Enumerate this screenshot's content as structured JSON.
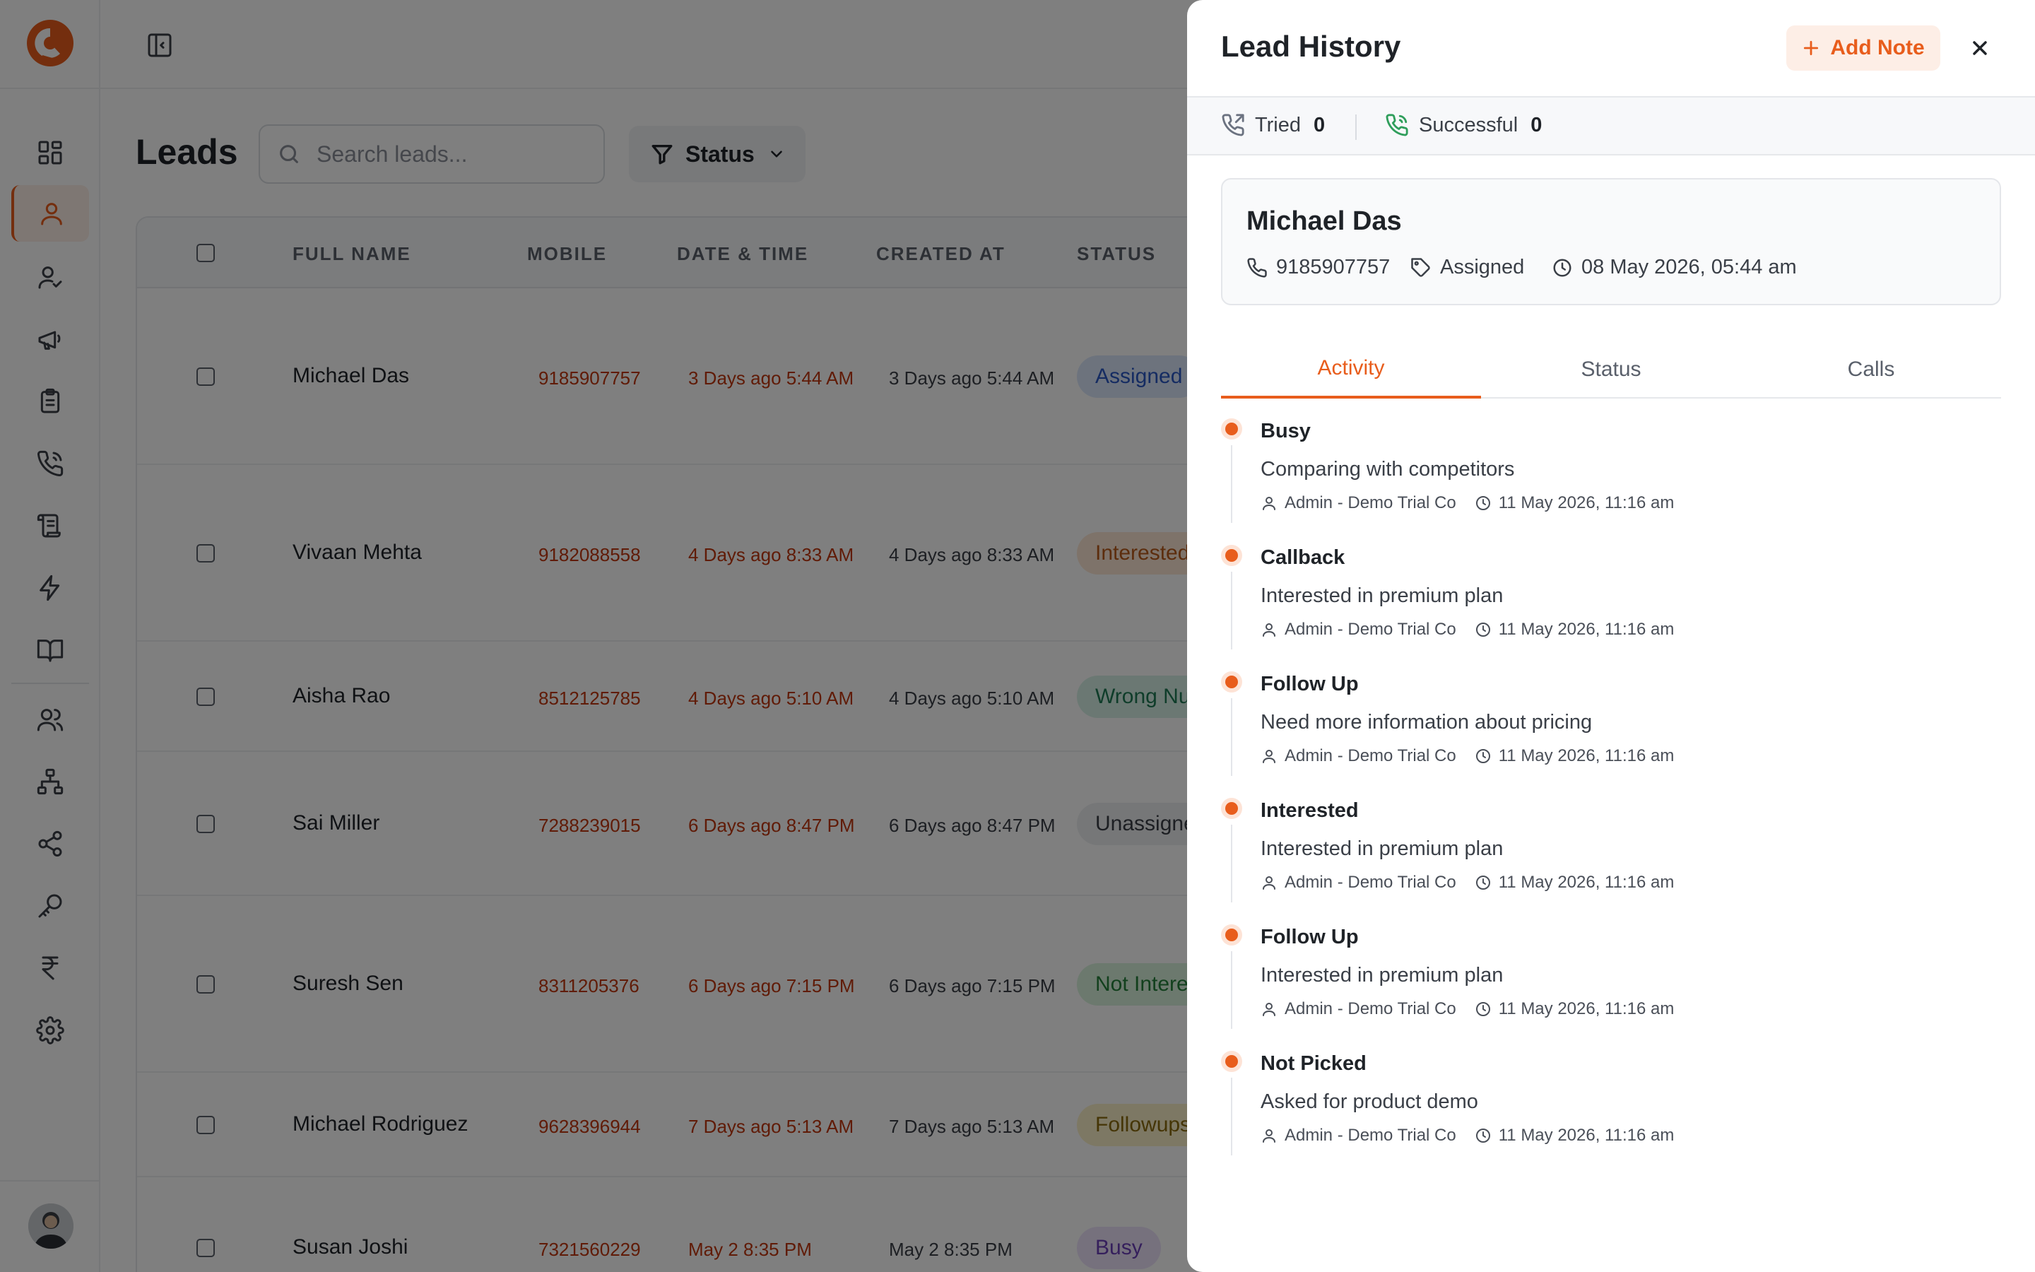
{
  "colors": {
    "accent": "#e85d1c",
    "accent_bg": "#fdeee6",
    "success": "#2f9e5b"
  },
  "sidebar": {
    "items": [
      {
        "icon": "dashboard-icon",
        "active": false
      },
      {
        "icon": "user-icon",
        "active": true
      },
      {
        "icon": "user-check-icon",
        "active": false
      },
      {
        "icon": "megaphone-icon",
        "active": false
      },
      {
        "icon": "clipboard-icon",
        "active": false
      },
      {
        "icon": "phone-call-icon",
        "active": false
      },
      {
        "icon": "scroll-icon",
        "active": false
      },
      {
        "icon": "lightning-icon",
        "active": false
      },
      {
        "icon": "book-icon",
        "active": false
      },
      {
        "icon": "users-icon",
        "active": false
      },
      {
        "icon": "org-chart-icon",
        "active": false
      },
      {
        "icon": "share-icon",
        "active": false
      },
      {
        "icon": "key-icon",
        "active": false
      },
      {
        "icon": "rupee-icon",
        "active": false
      },
      {
        "icon": "settings-icon",
        "active": false
      }
    ]
  },
  "leads_page": {
    "title": "Leads",
    "search": {
      "placeholder": "Search leads...",
      "value": ""
    },
    "status_filter": "Status",
    "columns": [
      "FULL NAME",
      "MOBILE",
      "DATE & TIME",
      "CREATED AT",
      "STATUS"
    ],
    "rows": [
      {
        "name": "Michael Das",
        "mobile": "9185907757",
        "date_time": "3 Days ago 5:44 AM",
        "created_at": "3 Days ago 5:44 AM",
        "status": "Assigned",
        "status_color": "#dbe6fb",
        "status_text_color": "#2b58c4"
      },
      {
        "name": "Vivaan Mehta",
        "mobile": "9182088558",
        "date_time": "4 Days ago 8:33 AM",
        "created_at": "4 Days ago 8:33 AM",
        "status": "Interested",
        "status_color": "#fde6d4",
        "status_text_color": "#b85a1a"
      },
      {
        "name": "Aisha Rao",
        "mobile": "8512125785",
        "date_time": "4 Days ago 5:10 AM",
        "created_at": "4 Days ago 5:10 AM",
        "status": "Wrong Nu",
        "status_color": "#d7f1e6",
        "status_text_color": "#1f7a55"
      },
      {
        "name": "Sai Miller",
        "mobile": "7288239015",
        "date_time": "6 Days ago 8:47 PM",
        "created_at": "6 Days ago 8:47 PM",
        "status": "Unassigne",
        "status_color": "#eceef1",
        "status_text_color": "#3a3f47"
      },
      {
        "name": "Suresh Sen",
        "mobile": "8311205376",
        "date_time": "6 Days ago 7:15 PM",
        "created_at": "6 Days ago 7:15 PM",
        "status": "Not Intere",
        "status_color": "#d9f2dd",
        "status_text_color": "#24803a"
      },
      {
        "name": "Michael Rodriguez",
        "mobile": "9628396944",
        "date_time": "7 Days ago 5:13 AM",
        "created_at": "7 Days ago 5:13 AM",
        "status": "Followups",
        "status_color": "#fbf1c8",
        "status_text_color": "#8a6a0c"
      },
      {
        "name": "Susan Joshi",
        "mobile": "7321560229",
        "date_time": "May 2 8:35 PM",
        "created_at": "May 2 8:35 PM",
        "status": "Busy",
        "status_color": "#ede3fb",
        "status_text_color": "#6b3fb8"
      }
    ]
  },
  "drawer": {
    "title": "Lead History",
    "add_note_label": "Add Note",
    "tried_label": "Tried",
    "tried_count": "0",
    "successful_label": "Successful",
    "successful_count": "0",
    "lead": {
      "name": "Michael Das",
      "phone": "9185907757",
      "status": "Assigned",
      "datetime": "08 May 2026, 05:44 am"
    },
    "tabs": [
      {
        "label": "Activity",
        "active": true
      },
      {
        "label": "Status",
        "active": false
      },
      {
        "label": "Calls",
        "active": false
      }
    ],
    "activities": [
      {
        "title": "Busy",
        "note": "Comparing with competitors",
        "user": "Admin - Demo Trial Co",
        "time": "11 May 2026, 11:16 am"
      },
      {
        "title": "Callback",
        "note": "Interested in premium plan",
        "user": "Admin - Demo Trial Co",
        "time": "11 May 2026, 11:16 am"
      },
      {
        "title": "Follow Up",
        "note": "Need more information about pricing",
        "user": "Admin - Demo Trial Co",
        "time": "11 May 2026, 11:16 am"
      },
      {
        "title": "Interested",
        "note": "Interested in premium plan",
        "user": "Admin - Demo Trial Co",
        "time": "11 May 2026, 11:16 am"
      },
      {
        "title": "Follow Up",
        "note": "Interested in premium plan",
        "user": "Admin - Demo Trial Co",
        "time": "11 May 2026, 11:16 am"
      },
      {
        "title": "Not Picked",
        "note": "Asked for product demo",
        "user": "Admin - Demo Trial Co",
        "time": "11 May 2026, 11:16 am"
      }
    ]
  }
}
